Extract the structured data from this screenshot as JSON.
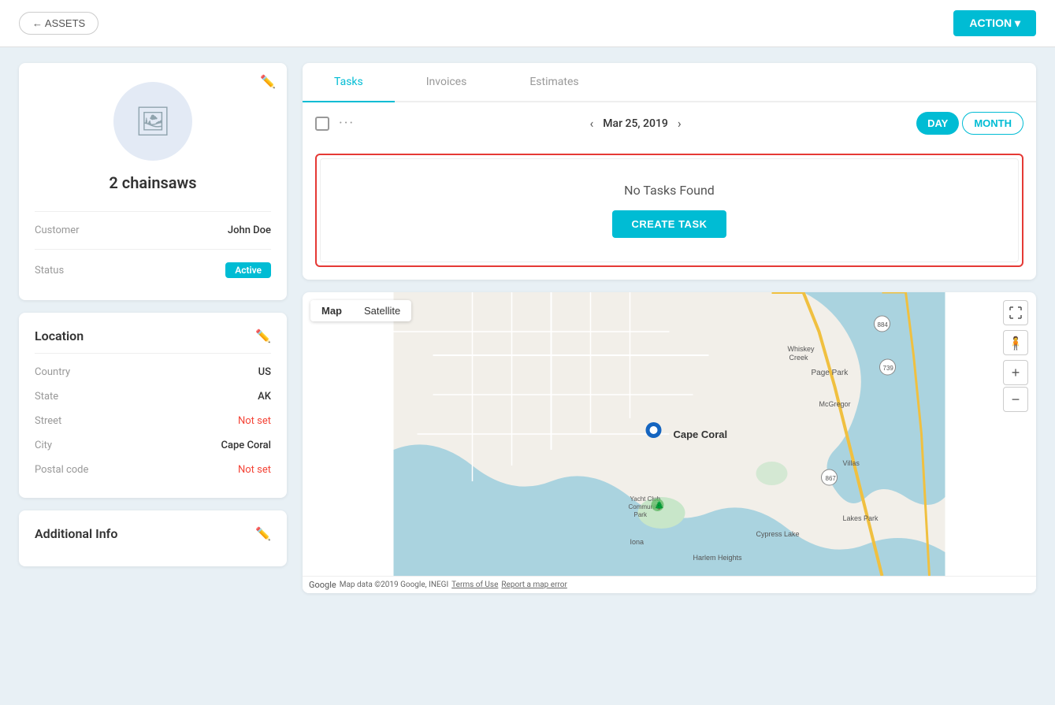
{
  "nav": {
    "back_label": "← ASSETS",
    "action_label": "ACTION ▾"
  },
  "profile": {
    "name": "2 chainsaws",
    "customer_label": "Customer",
    "customer_value": "John Doe",
    "status_label": "Status",
    "status_value": "Active"
  },
  "location": {
    "section_title": "Location",
    "country_label": "Country",
    "country_value": "US",
    "state_label": "State",
    "state_value": "AK",
    "street_label": "Street",
    "street_value": "Not set",
    "city_label": "City",
    "city_value": "Cape Coral",
    "postal_label": "Postal code",
    "postal_value": "Not set"
  },
  "additional_info": {
    "section_title": "Additional Info"
  },
  "tabs": {
    "items": [
      {
        "label": "Tasks",
        "active": true
      },
      {
        "label": "Invoices",
        "active": false
      },
      {
        "label": "Estimates",
        "active": false
      }
    ]
  },
  "task_toolbar": {
    "date": "Mar 25, 2019",
    "day_label": "DAY",
    "month_label": "MONTH"
  },
  "no_tasks": {
    "message": "No Tasks Found",
    "create_btn": "CREATE TASK"
  },
  "map": {
    "map_btn": "Map",
    "satellite_btn": "Satellite",
    "location_label": "Cape Coral",
    "footer": "Map data ©2019 Google, INEGI",
    "terms": "Terms of Use",
    "report": "Report a map error"
  }
}
